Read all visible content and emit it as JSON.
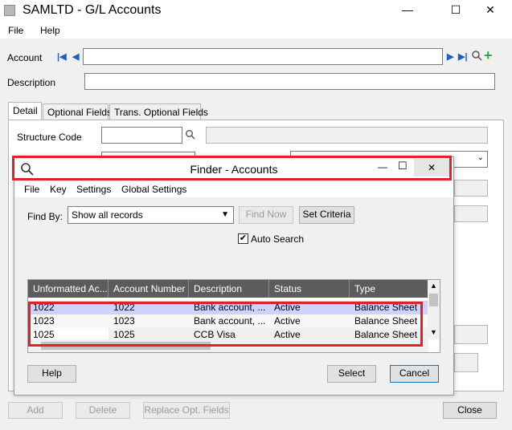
{
  "window": {
    "title": "SAMLTD - G/L Accounts",
    "minimize": "—",
    "maximize": "☐",
    "close": "✕"
  },
  "menu": {
    "file": "File",
    "help": "Help"
  },
  "form": {
    "account_label": "Account",
    "description_label": "Description",
    "structure_code_label": "Structure Code"
  },
  "tabs": [
    {
      "label": "Detail"
    },
    {
      "label": "Optional Fields"
    },
    {
      "label": "Trans. Optional Fields"
    }
  ],
  "bottom": {
    "add": "Add",
    "delete": "Delete",
    "replace": "Replace Opt. Fields",
    "close": "Close"
  },
  "finder": {
    "title": "Finder - Accounts",
    "menu": {
      "file": "File",
      "key": "Key",
      "settings": "Settings",
      "global": "Global Settings"
    },
    "find_by_label": "Find By:",
    "find_by_value": "Show all records",
    "find_now": "Find Now",
    "set_criteria": "Set Criteria",
    "auto_search": "Auto Search",
    "columns": [
      "Unformatted Ac...",
      "Account Number",
      "Description",
      "Status",
      "Type"
    ],
    "rows": [
      [
        "1022",
        "1022",
        "Bank account, ...",
        "Active",
        "Balance Sheet"
      ],
      [
        "1023",
        "1023",
        "Bank account, ...",
        "Active",
        "Balance Sheet"
      ],
      [
        "1025",
        "1025",
        "CCB Visa",
        "Active",
        "Balance Sheet"
      ]
    ],
    "help": "Help",
    "select": "Select",
    "cancel": "Cancel"
  },
  "colors": {
    "highlight": "#e2202b",
    "selected_row": "#cdd3ff",
    "header": "#5c5c5c",
    "add_icon": "#2ea84a"
  }
}
